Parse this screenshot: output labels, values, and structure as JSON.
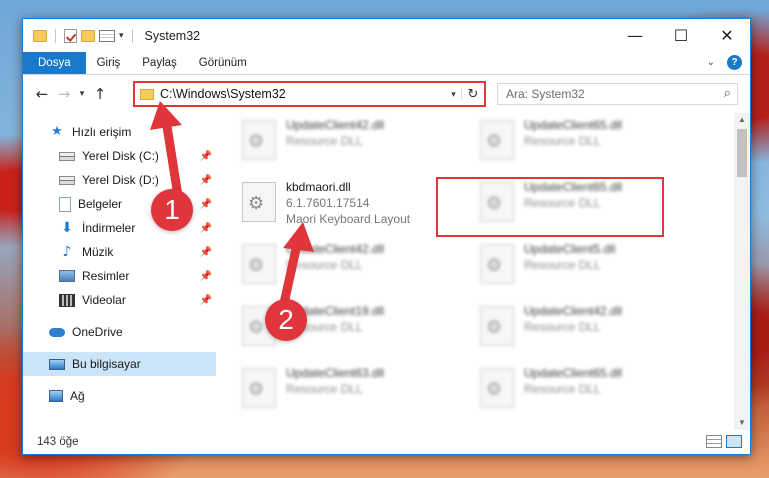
{
  "window": {
    "title": "System32",
    "controls": {
      "minimize": "—",
      "maximize": "☐",
      "close": "✕"
    }
  },
  "ribbon": {
    "tabs": [
      "Dosya",
      "Giriş",
      "Paylaş",
      "Görünüm"
    ]
  },
  "address_bar": {
    "path": "C:\\Windows\\System32"
  },
  "search": {
    "placeholder": "Ara: System32"
  },
  "nav_pane": {
    "quick_access": "Hızlı erişim",
    "quick_items": [
      "Yerel Disk (C:)",
      "Yerel Disk (D:)",
      "Belgeler",
      "İndirmeler",
      "Müzik",
      "Resimler",
      "Videolar"
    ],
    "onedrive": "OneDrive",
    "this_pc": "Bu bilgisayar",
    "network": "Ağ"
  },
  "files": {
    "highlighted": {
      "name": "kbdmaori.dll",
      "version": "6.1.7601.17514",
      "description": "Maori Keyboard Layout"
    },
    "left_column": [
      {
        "name": "UpdateClient42.dll",
        "type": "Resource DLL"
      },
      {
        "name": "UpdateClient42.dll",
        "type": "Resource DLL"
      },
      {
        "name": "UpdateClient19.dll",
        "type": "Resource DLL"
      },
      {
        "name": "UpdateClient63.dll",
        "type": "Resource DLL"
      }
    ],
    "right_column": [
      {
        "name": "UpdateClient65.dll",
        "type": "Resource DLL"
      },
      {
        "name": "UpdateClient65.dll",
        "type": "Resource DLL"
      },
      {
        "name": "UpdateClient5.dll",
        "type": "Resource DLL"
      },
      {
        "name": "UpdateClient42.dll",
        "type": "Resource DLL"
      },
      {
        "name": "UpdateClient65.dll",
        "type": "Resource DLL"
      }
    ]
  },
  "status_bar": {
    "item_count": "143 öğe"
  },
  "annotations": {
    "marker1": "1",
    "marker2": "2",
    "color": "#e0363b"
  }
}
